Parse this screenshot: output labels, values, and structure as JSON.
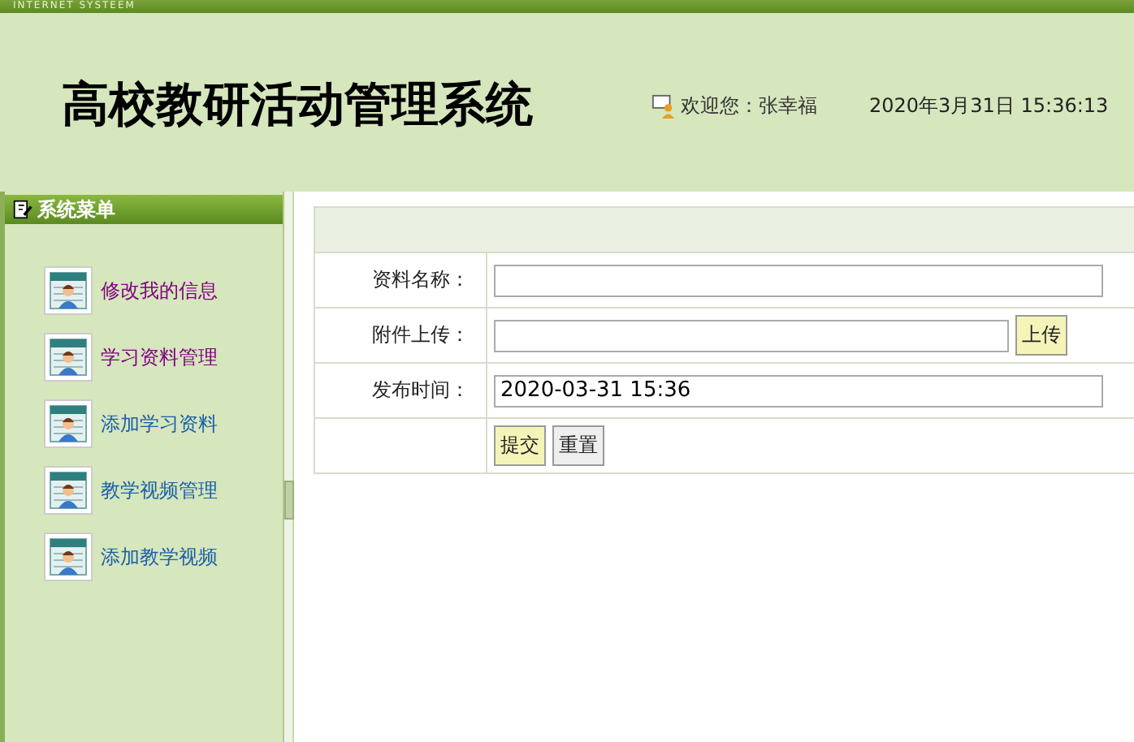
{
  "top_strip": {
    "text": "INTERNET SYSTEEM"
  },
  "header": {
    "title": "高校教研活动管理系统",
    "welcome": "欢迎您：张幸福",
    "datetime": "2020年3月31日 15:36:13"
  },
  "sidebar": {
    "title": "系统菜单",
    "items": [
      {
        "label": "修改我的信息",
        "color": "#800080"
      },
      {
        "label": "学习资料管理",
        "color": "#800080"
      },
      {
        "label": "添加学习资料",
        "color": "#1a5fa8"
      },
      {
        "label": "教学视频管理",
        "color": "#1a5fa8"
      },
      {
        "label": "添加教学视频",
        "color": "#1a5fa8"
      }
    ]
  },
  "form": {
    "rows": [
      {
        "label": "资料名称：",
        "value": ""
      },
      {
        "label": "附件上传：",
        "value": "",
        "button": {
          "label": "上传",
          "highlighted": true
        }
      },
      {
        "label": "发布时间：",
        "value": "2020-03-31 15:36"
      }
    ],
    "buttons": [
      {
        "label": "提交",
        "highlighted": true
      },
      {
        "label": "重置",
        "highlighted": false
      }
    ]
  }
}
